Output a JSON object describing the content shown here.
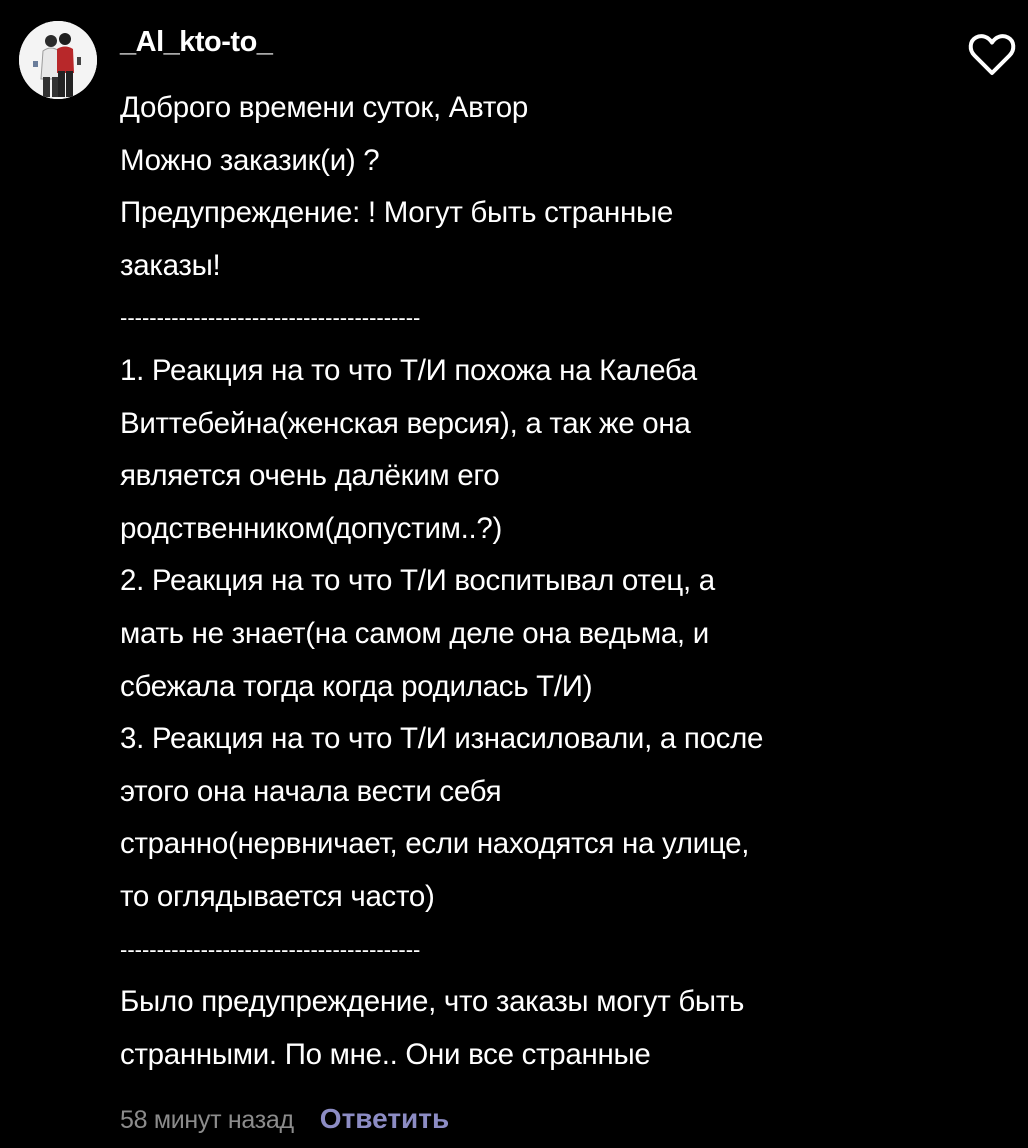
{
  "comment": {
    "username": "_Al_kto-to_",
    "icons": {
      "avatar": "user-avatar-photo",
      "like": "heart-outline-icon"
    },
    "body_lines": [
      "Доброго времени суток, Автор",
      "Можно заказик(и) ?",
      "Предупреждение: ! Могут быть странные",
      "заказы!",
      "-----------------------------------------",
      "1. Реакция на то что Т/И похожа на Калеба",
      "Виттебейна(женская версия), а так же она",
      "является очень далёким его",
      "родственником(допустим..?)",
      "2. Реакция на то что Т/И воспитывал отец, а",
      "мать не знает(на самом деле она ведьма, и",
      "сбежала тогда когда родилась Т/И)",
      "3. Реакция на то что Т/И изнасиловали, а после",
      "этого она начала вести себя",
      "странно(нервничает, если находятся на улице,",
      "то оглядывается часто)",
      "-----------------------------------------",
      "Было предупреждение, что заказы могут быть",
      "странными. По мне.. Они все странные"
    ],
    "timestamp": "58 минут назад",
    "reply_label": "Ответить"
  },
  "colors": {
    "background": "#000000",
    "text": "#ffffff",
    "muted": "#8c8c8c",
    "reply_accent": "#8c8cc4"
  }
}
